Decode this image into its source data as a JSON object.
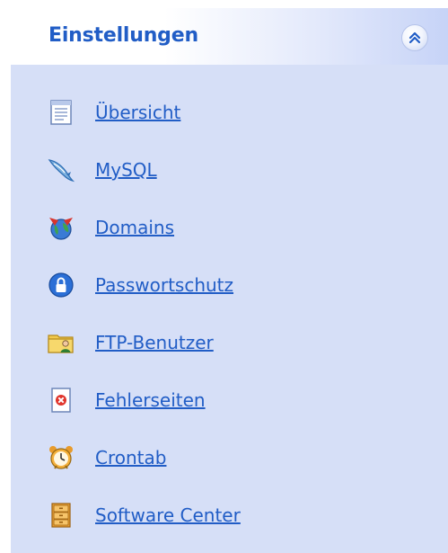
{
  "panel": {
    "title": "Einstellungen",
    "collapse_icon": "chevron-double-up-icon",
    "items": [
      {
        "label": "Übersicht",
        "icon": "document-icon"
      },
      {
        "label": "MySQL",
        "icon": "mysql-dolphin-icon"
      },
      {
        "label": "Domains",
        "icon": "domains-globe-icon"
      },
      {
        "label": "Passwortschutz",
        "icon": "shield-lock-icon"
      },
      {
        "label": "FTP-Benutzer",
        "icon": "ftp-user-folder-icon"
      },
      {
        "label": "Fehlerseiten",
        "icon": "error-page-icon"
      },
      {
        "label": "Crontab",
        "icon": "alarm-clock-icon"
      },
      {
        "label": "Software Center",
        "icon": "software-cabinet-icon"
      }
    ]
  },
  "colors": {
    "link": "#215dc6",
    "panel_bg": "#d6dff7"
  }
}
